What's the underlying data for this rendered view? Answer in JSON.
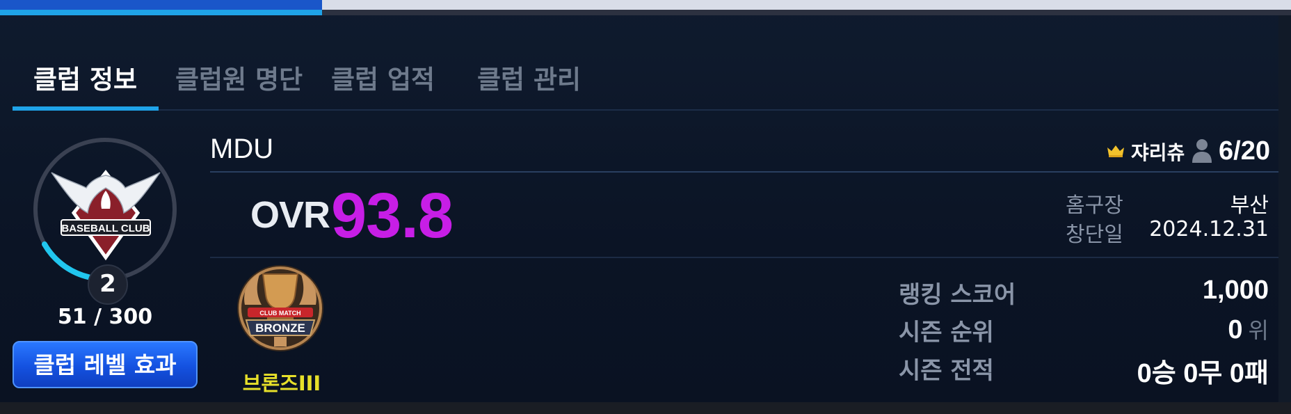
{
  "top_bar": {
    "progress": 0.25
  },
  "tabs": [
    {
      "label": "클럽 정보",
      "active": true
    },
    {
      "label": "클럽원 명단",
      "active": false
    },
    {
      "label": "클럽 업적",
      "active": false
    },
    {
      "label": "클럽 관리",
      "active": false
    }
  ],
  "level": {
    "value": "2",
    "exp_text": "51 / 300",
    "exp_progress": 0.17,
    "button_label": "클럽 레벨 효과",
    "emblem_text": "BASEBALL CLUB"
  },
  "club": {
    "name": "MDU",
    "owner": "쟈리츄",
    "members": "6/20",
    "ovr_label": "OVR",
    "ovr_value": "93.8",
    "home_label": "홈구장",
    "home_value": "부산",
    "founded_label": "창단일",
    "founded_value": "2024.12.31"
  },
  "tier": {
    "name": "브론즈III",
    "badge_text": "BRONZE",
    "badge_subtext": "CLUB MATCH"
  },
  "stats": {
    "ranking_label": "랭킹 스코어",
    "ranking_value": "1,000",
    "season_rank_label": "시즌 순위",
    "season_rank_value": "0",
    "season_rank_unit": "위",
    "season_record_label": "시즌 전적",
    "season_record_value": "0승 0무 0패"
  },
  "colors": {
    "accent": "#1fa3e8",
    "ovr": "#c71ee6",
    "tier": "#e7e02a",
    "button": "#1451e0"
  }
}
